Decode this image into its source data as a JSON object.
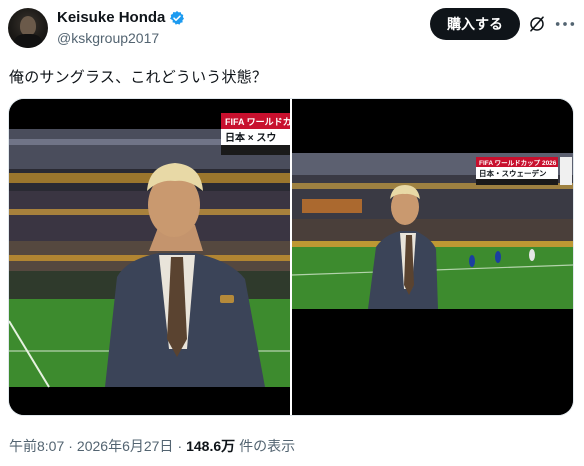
{
  "author": {
    "display_name": "Keisuke Honda",
    "handle": "@kskgroup2017",
    "verified": true
  },
  "actions": {
    "buy_label": "購入する"
  },
  "tweet": {
    "text": "俺のサングラス、これどういう状態？"
  },
  "media": {
    "left": {
      "overlay_brand": "FIFA ワールドカップ",
      "overlay_match": "日本 × スウ"
    },
    "right": {
      "overlay_brand": "FIFA ワールドカップ 2026",
      "overlay_match": "日本・スウェーデン"
    }
  },
  "meta": {
    "time": "午前8:07",
    "separator": "·",
    "date": "2026年6月27日",
    "views": "148.6万",
    "views_suffix": "件の表示"
  },
  "colors": {
    "accent": "#1d9bf0",
    "button_bg": "#0f1419",
    "muted_text": "#536471",
    "pitch_green": "#3d8b2e",
    "overlay_red": "#c8102e"
  }
}
